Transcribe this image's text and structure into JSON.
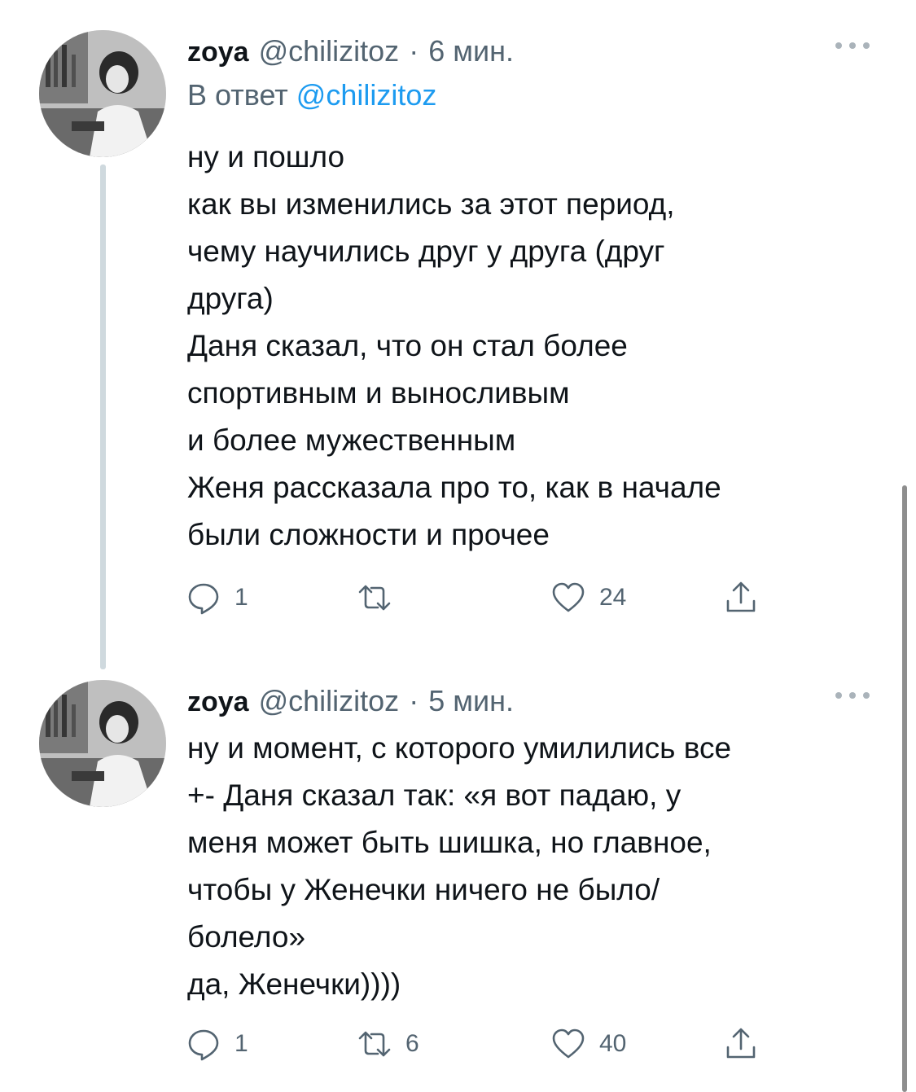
{
  "colors": {
    "text": "#0f1419",
    "secondary": "#536471",
    "link": "#1d9bf0",
    "thread_line": "#cfd9de"
  },
  "tweets": [
    {
      "author": "zoya",
      "handle": "@chilizitoz",
      "separator": "·",
      "time": "6 мин.",
      "reply_prefix": "В ответ",
      "reply_handle": "@chilizitoz",
      "lines": [
        "ну и пошло",
        "как вы изменились за этот период,",
        "чему научились друг у друга (друг",
        "друга)",
        "Даня сказал, что он стал более",
        "спортивным и выносливым",
        "и более мужественным",
        "Женя рассказала про то, как в начале",
        "были сложности и прочее"
      ],
      "replies": "1",
      "retweets": "",
      "likes": "24",
      "icons": [
        "avatar-photo",
        "more-icon",
        "reply-icon",
        "retweet-icon",
        "like-icon",
        "share-icon"
      ]
    },
    {
      "author": "zoya",
      "handle": "@chilizitoz",
      "separator": "·",
      "time": "5 мин.",
      "lines": [
        "ну и момент, с которого умилились все",
        "+- Даня сказал так: «я вот падаю, у",
        "меня может быть шишка, но главное,",
        "чтобы у Женечки ничего не было/",
        "болело»",
        "да, Женечки))))"
      ],
      "replies": "1",
      "retweets": "6",
      "likes": "40",
      "icons": [
        "avatar-photo",
        "more-icon",
        "reply-icon",
        "retweet-icon",
        "like-icon",
        "share-icon"
      ]
    }
  ]
}
